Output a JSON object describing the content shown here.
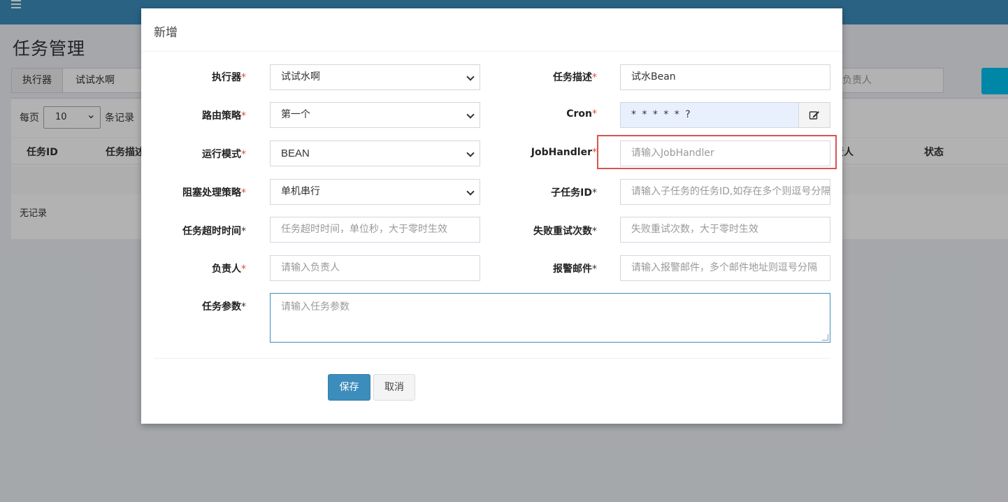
{
  "page": {
    "title": "任务管理",
    "filter": {
      "executor_label": "执行器",
      "executor_value": "试试水啊",
      "owner_placeholder": "负责人"
    },
    "per_page_prefix": "每页",
    "per_page_value": "10",
    "per_page_suffix": "条记录",
    "table_headers": [
      "任务ID",
      "任务描述",
      "负责人",
      "状态"
    ],
    "empty_text": "无记录"
  },
  "modal": {
    "title": "新增",
    "fields": {
      "executor": {
        "label": "执行器",
        "value": "试试水啊"
      },
      "job_desc": {
        "label": "任务描述",
        "value": "试水Bean"
      },
      "route_strategy": {
        "label": "路由策略",
        "value": "第一个"
      },
      "cron": {
        "label": "Cron",
        "value": "* * * * * ?"
      },
      "run_mode": {
        "label": "运行模式",
        "value": "BEAN"
      },
      "job_handler": {
        "label": "JobHandler",
        "placeholder": "请输入JobHandler"
      },
      "block_strategy": {
        "label": "阻塞处理策略",
        "value": "单机串行"
      },
      "child_job_id": {
        "label": "子任务ID",
        "placeholder": "请输入子任务的任务ID,如存在多个则逗号分隔"
      },
      "timeout": {
        "label": "任务超时时间",
        "placeholder": "任务超时时间，单位秒，大于零时生效"
      },
      "retry": {
        "label": "失败重试次数",
        "placeholder": "失败重试次数，大于零时生效"
      },
      "author": {
        "label": "负责人",
        "placeholder": "请输入负责人"
      },
      "alarm_email": {
        "label": "报警邮件",
        "placeholder": "请输入报警邮件，多个邮件地址则逗号分隔"
      },
      "params": {
        "label": "任务参数",
        "placeholder": "请输入任务参数"
      }
    },
    "required_mark": "*",
    "save_label": "保存",
    "cancel_label": "取消"
  },
  "colors": {
    "header_bar": "#3c8dbc",
    "primary_button": "#3c8dbc",
    "required_star": "#dd4b39",
    "highlight_box": "#d9534f",
    "cron_field_bg": "#e8f0fe"
  }
}
